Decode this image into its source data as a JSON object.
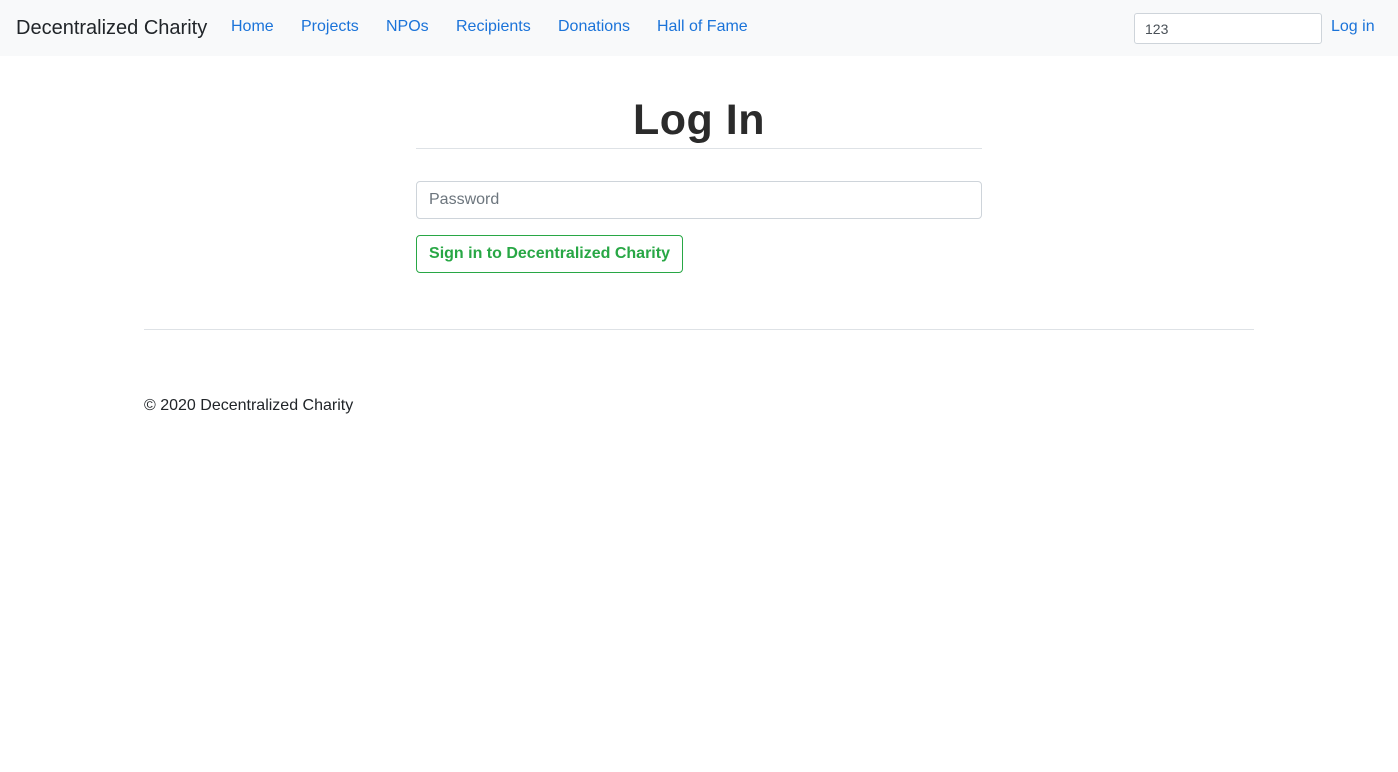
{
  "navbar": {
    "brand": "Decentralized Charity",
    "links": [
      {
        "label": "Home"
      },
      {
        "label": "Projects"
      },
      {
        "label": "NPOs"
      },
      {
        "label": "Recipients"
      },
      {
        "label": "Donations"
      },
      {
        "label": "Hall of Fame"
      }
    ],
    "search": {
      "value": "123"
    },
    "login_label": "Log in"
  },
  "login": {
    "heading": "Log In",
    "password_placeholder": "Password",
    "password_value": "",
    "submit_label": "Sign in to Decentralized Charity"
  },
  "footer": {
    "text": "© 2020 Decentralized Charity"
  },
  "colors": {
    "link": "#1a73d9",
    "navbar_bg": "#f8f9fa",
    "success": "#28a745",
    "text": "#212529"
  }
}
